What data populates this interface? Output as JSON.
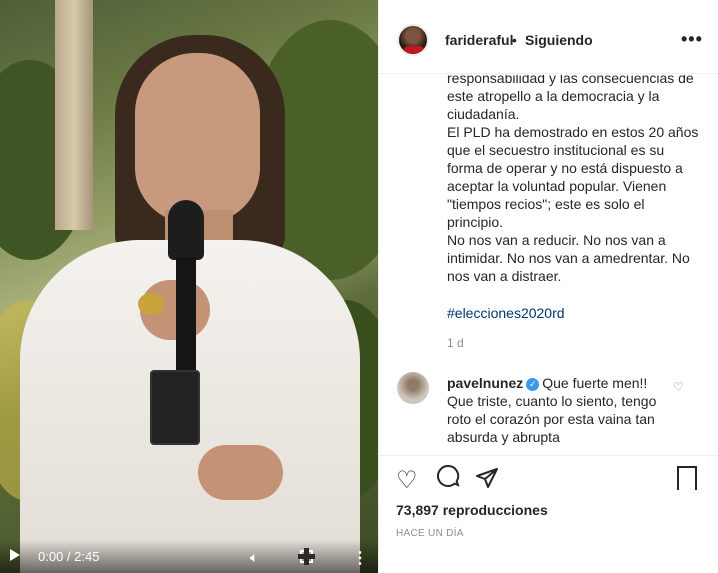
{
  "video": {
    "time_label": "0:00 / 2:45"
  },
  "header": {
    "username": "farideraful",
    "separator": "•",
    "follow_status": "Siguiendo",
    "options_label": "•••"
  },
  "caption": {
    "text": "responsabilidad y las consecuencias de este atropello a la democracia y la ciudadanía.\nEl PLD ha demostrado en estos 20 años que el secuestro institucional es su forma de operar y no está dispuesto a aceptar la voluntad popular. Vienen \"tiempos recios\"; este es solo el principio.\nNo nos van a reducir. No nos van a intimidar.  No nos van a amedrentar. No nos van a distraer.",
    "hashtag": "#elecciones2020rd",
    "age": "1 d"
  },
  "comment": {
    "user": "pavelnunez",
    "text_first": "Que fuerte men!!",
    "text_rest": "Que triste, cuanto lo siento, tengo roto el corazón por esta vaina tan absurda y abrupta"
  },
  "actions": {
    "views": "73,897 reproducciones",
    "posted": "HACE UN DÍA"
  },
  "icons": [
    "play-icon",
    "volume-icon",
    "fullscreen-icon",
    "more-vertical-icon",
    "heart-icon",
    "comment-icon",
    "share-icon",
    "save-icon",
    "verified-icon",
    "like-comment-icon"
  ],
  "colors": {
    "link": "#00376b",
    "verified": "#3897f0",
    "text": "#262626",
    "muted": "#8e8e8e"
  }
}
